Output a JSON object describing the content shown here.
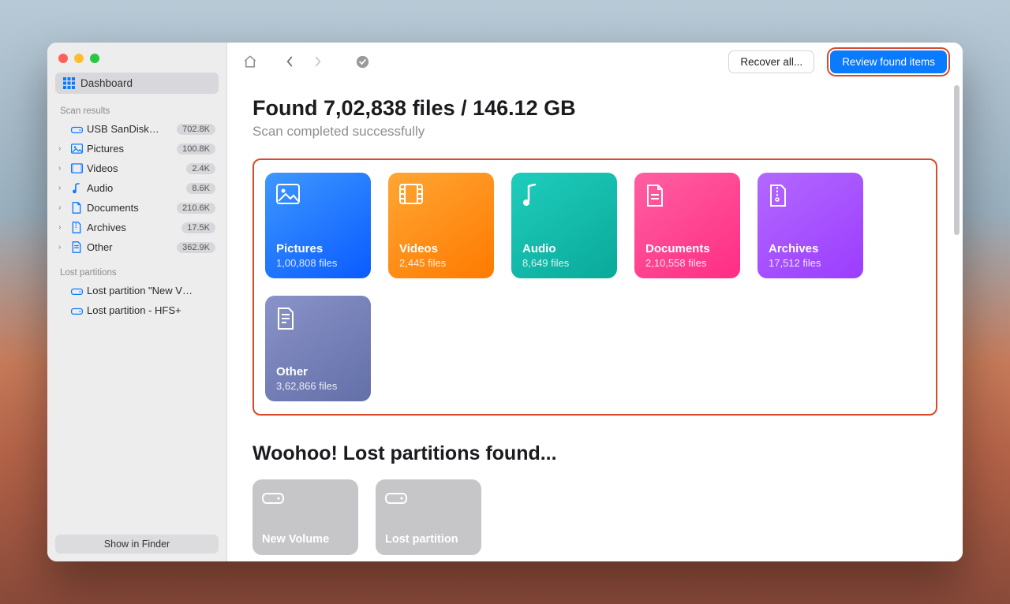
{
  "sidebar": {
    "dashboard_label": "Dashboard",
    "section_scan": "Scan results",
    "section_lost": "Lost partitions",
    "drive": {
      "label": "USB  SanDisk…",
      "badge": "702.8K"
    },
    "items": [
      {
        "label": "Pictures",
        "badge": "100.8K"
      },
      {
        "label": "Videos",
        "badge": "2.4K"
      },
      {
        "label": "Audio",
        "badge": "8.6K"
      },
      {
        "label": "Documents",
        "badge": "210.6K"
      },
      {
        "label": "Archives",
        "badge": "17.5K"
      },
      {
        "label": "Other",
        "badge": "362.9K"
      }
    ],
    "lost": [
      {
        "label": "Lost partition \"New V…"
      },
      {
        "label": "Lost partition - HFS+"
      }
    ],
    "footer_button": "Show in Finder"
  },
  "toolbar": {
    "recover_label": "Recover all...",
    "review_label": "Review found items"
  },
  "main": {
    "title": "Found 7,02,838 files / 146.12 GB",
    "subtitle": "Scan completed successfully",
    "cards": [
      {
        "title": "Pictures",
        "sub": "1,00,808 files"
      },
      {
        "title": "Videos",
        "sub": "2,445 files"
      },
      {
        "title": "Audio",
        "sub": "8,649 files"
      },
      {
        "title": "Documents",
        "sub": "2,10,558 files"
      },
      {
        "title": "Archives",
        "sub": "17,512 files"
      },
      {
        "title": "Other",
        "sub": "3,62,866 files"
      }
    ],
    "section2_heading": "Woohoo! Lost partitions found...",
    "partitions": [
      {
        "title": "New Volume"
      },
      {
        "title": "Lost partition"
      }
    ]
  },
  "colors": {
    "accent": "#0a7aff",
    "highlight_border": "#d94a2b"
  }
}
